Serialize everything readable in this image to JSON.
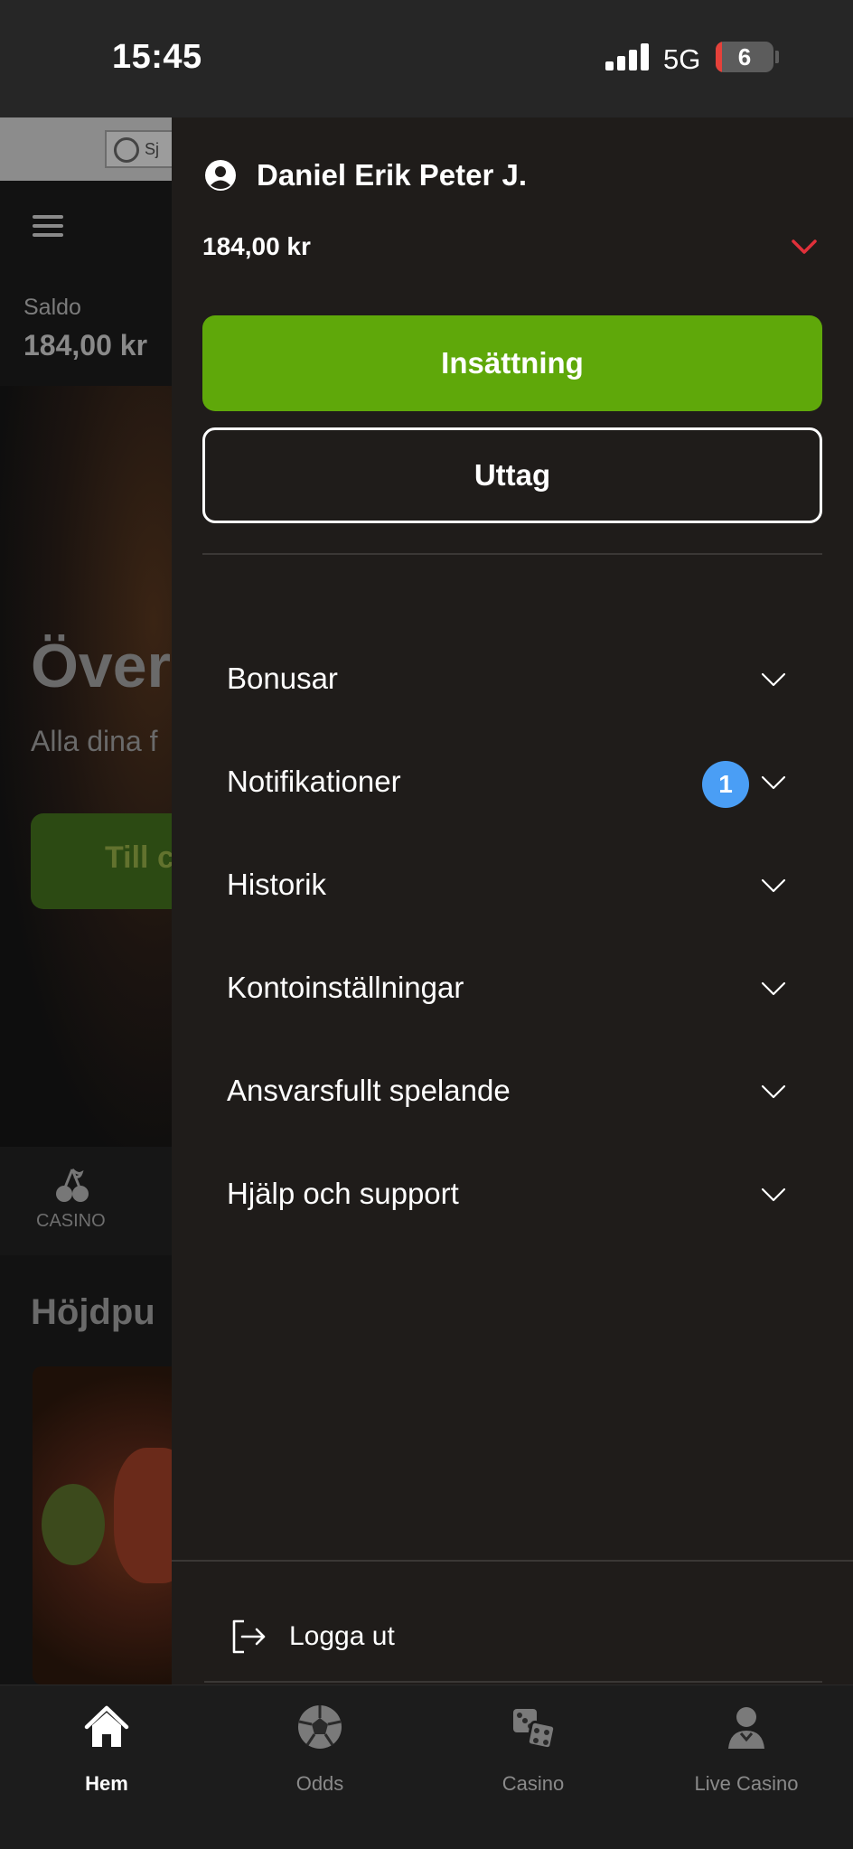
{
  "status_bar": {
    "time": "15:45",
    "network": "5G",
    "battery": "6"
  },
  "background": {
    "banner_text": "Sj",
    "saldo_label": "Saldo",
    "saldo_value": "184,00 kr",
    "hero_title": "Över",
    "hero_subtitle": "Alla dina f",
    "hero_button": "Till c",
    "category_label": "CASINO",
    "section_title": "Höjdpu"
  },
  "drawer": {
    "user_name": "Daniel Erik Peter J.",
    "balance": "184,00 kr",
    "deposit_label": "Insättning",
    "withdraw_label": "Uttag",
    "menu": [
      {
        "label": "Bonusar"
      },
      {
        "label": "Notifikationer",
        "badge": "1"
      },
      {
        "label": "Historik"
      },
      {
        "label": "Kontoinställningar"
      },
      {
        "label": "Ansvarsfullt spelande"
      },
      {
        "label": "Hjälp och support"
      }
    ],
    "logout_label": "Logga ut"
  },
  "bottom_nav": {
    "items": [
      {
        "label": "Hem",
        "icon": "home-icon",
        "active": true
      },
      {
        "label": "Odds",
        "icon": "football-icon",
        "active": false
      },
      {
        "label": "Casino",
        "icon": "dice-icon",
        "active": false
      },
      {
        "label": "Live Casino",
        "icon": "dealer-icon",
        "active": false
      }
    ]
  },
  "colors": {
    "accent_green": "#5fa80a",
    "badge_blue": "#4a9ef5",
    "chevron_red": "#e0303a",
    "drawer_bg": "#1f1c1a"
  }
}
